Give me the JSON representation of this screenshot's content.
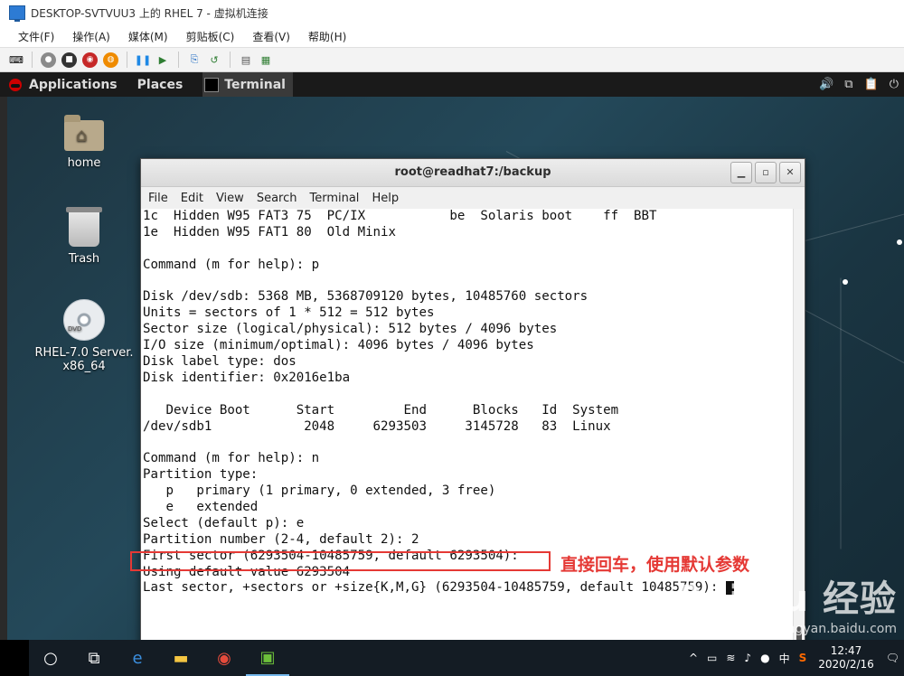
{
  "host_window": {
    "title": "DESKTOP-SVTVUU3 上的 RHEL 7 - 虚拟机连接",
    "menu": [
      "文件(F)",
      "操作(A)",
      "媒体(M)",
      "剪贴板(C)",
      "查看(V)",
      "帮助(H)"
    ]
  },
  "gnome_bar": {
    "applications": "Applications",
    "places": "Places",
    "task": "Terminal"
  },
  "desktop_icons": {
    "home": "home",
    "trash": "Trash",
    "dvd_line1": "RHEL-7.0 Server.",
    "dvd_line2": "x86_64"
  },
  "terminal": {
    "title": "root@readhat7:/backup",
    "menu": [
      "File",
      "Edit",
      "View",
      "Search",
      "Terminal",
      "Help"
    ],
    "lines": [
      "1c  Hidden W95 FAT3 75  PC/IX           be  Solaris boot    ff  BBT",
      "1e  Hidden W95 FAT1 80  Old Minix",
      "",
      "Command (m for help): p",
      "",
      "Disk /dev/sdb: 5368 MB, 5368709120 bytes, 10485760 sectors",
      "Units = sectors of 1 * 512 = 512 bytes",
      "Sector size (logical/physical): 512 bytes / 4096 bytes",
      "I/O size (minimum/optimal): 4096 bytes / 4096 bytes",
      "Disk label type: dos",
      "Disk identifier: 0x2016e1ba",
      "",
      "   Device Boot      Start         End      Blocks   Id  System",
      "/dev/sdb1            2048     6293503     3145728   83  Linux",
      "",
      "Command (m for help): n",
      "Partition type:",
      "   p   primary (1 primary, 0 extended, 3 free)",
      "   e   extended",
      "Select (default p): e",
      "Partition number (2-4, default 2): 2",
      "First sector (6293504-10485759, default 6293504):",
      "Using default value 6293504",
      "Last sector, +sectors or +size{K,M,G} (6293504-10485759, default 10485759): "
    ]
  },
  "annotation": "直接回车，使用默认参数",
  "watermark": {
    "brand": "Bai du 经验",
    "url": "jingyan.baidu.com"
  },
  "taskbar": {
    "ime": "中",
    "time": "12:47",
    "date": "2020/2/16"
  }
}
